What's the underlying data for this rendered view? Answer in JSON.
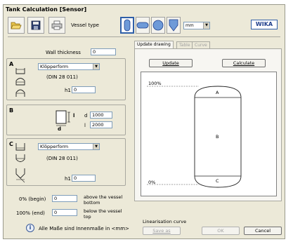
{
  "window": {
    "title": "Tank Calculation   [Sensor]"
  },
  "toolbar": {
    "open_icon": "open-folder-icon",
    "save_icon": "save-disk-icon",
    "print_icon": "printer-icon",
    "vessel_type_label": "Vessel type",
    "unit_value": "mm",
    "brand": "WIKA"
  },
  "wall": {
    "label": "Wall thickness",
    "value": "0"
  },
  "section_a": {
    "letter": "A",
    "shape": "Klöpperform",
    "norm": "(DIN 28 011)",
    "h1_label": "h1",
    "h1_value": "0"
  },
  "section_b": {
    "letter": "B",
    "d_label": "d",
    "d_value": "1000",
    "l_label": "l",
    "l_value": "2000",
    "diagram_d": "d",
    "diagram_l": "l"
  },
  "section_c": {
    "letter": "C",
    "shape": "Klöpperform",
    "norm": "(DIN 28 011)",
    "h1_label": "h1",
    "h1_value": "0"
  },
  "range": {
    "begin_label": "0% (begin)",
    "begin_value": "0",
    "begin_desc_1": "above the vessel",
    "begin_desc_2": "bottom",
    "end_label": "100% (end)",
    "end_value": "0",
    "end_desc_1": "below the vessel",
    "end_desc_2": "top"
  },
  "info": {
    "text": "Alle Maße sind Innenmaße in <mm>"
  },
  "tabs": [
    {
      "label": "Update drawing"
    },
    {
      "label": "Table"
    },
    {
      "label": "Curve"
    }
  ],
  "panel": {
    "update_label": "Update",
    "calculate_label": "Calculate"
  },
  "drawing": {
    "top_label": "100%",
    "bottom_label": "0%",
    "section_a": "A",
    "section_b": "B",
    "section_c": "C"
  },
  "footer": {
    "linearisation_label": "Linearisation curve",
    "save_as_label": "Save as",
    "ok_label": "OK",
    "cancel_label": "Cancel"
  }
}
